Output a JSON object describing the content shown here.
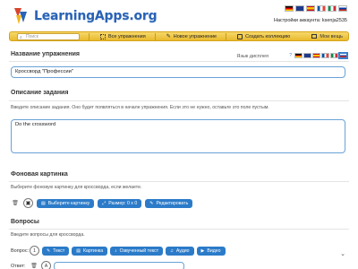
{
  "header": {
    "logo_text": "LearningApps.org",
    "account_label": "Настройки аккаунта:",
    "account_user": "ksenja2535",
    "language_flags": [
      "de",
      "gb",
      "es",
      "fr",
      "it",
      "ru"
    ]
  },
  "toolbar": {
    "search_placeholder": "Поиск",
    "all_exercises": "Все упражнения",
    "new_exercise": "Новое упражнение",
    "create_collection": "Создать коллекцию",
    "my_stuff": "Мои вещь"
  },
  "sections": {
    "name": {
      "title": "Название упражнения",
      "value": "Кроссворд \"Профессии\"",
      "display_language_label": "Язык дисплея"
    },
    "description": {
      "title": "Описание задания",
      "hint": "Введите описание задания. Оно будет появляться в начале упражнения. Если это не нужно, оставьте это поле пустым.",
      "value": "Do the crossword"
    },
    "background": {
      "title": "Фоновая картинка",
      "hint": "Выберите фоновую картинку для кроссворда, если желаете.",
      "choose_btn": "Выберите картинку",
      "size_btn": "Размер: 0 x 0",
      "edit_btn": "Редактировать"
    },
    "questions": {
      "title": "Вопросы",
      "hint": "Введите вопросы для кроссворда.",
      "question_label": "Вопрос:",
      "answer_label": "Ответ:",
      "types": [
        "Текст",
        "Картинка",
        "Озвученный текст",
        "Аудио",
        "Видео"
      ]
    }
  },
  "colors": {
    "accent_blue": "#2b7bc9",
    "toolbar_yellow": "#f0c94a",
    "logo_blue": "#2a63b5"
  }
}
